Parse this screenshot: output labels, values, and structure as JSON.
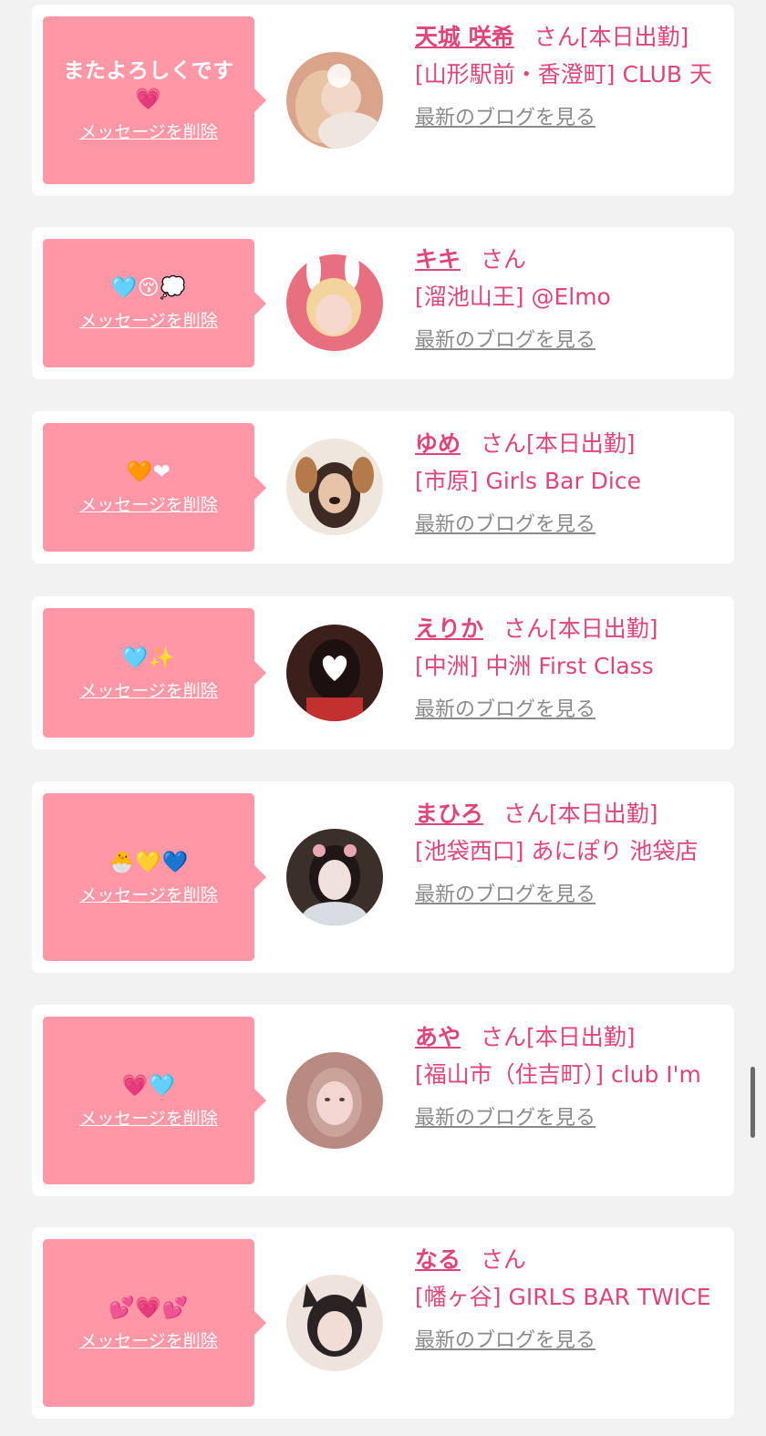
{
  "cards": [
    {
      "message": "またよろしくです💗",
      "delete_label": "メッセージを削除",
      "name": "天城 咲希",
      "san": "さん",
      "status": "[本日出勤]",
      "shop": "[山形駅前・香澄町] CLUB 天",
      "blog_label": "最新のブログを見る",
      "avatar_icon": "avatar-photo-icon",
      "avatar_colors": [
        "#d9a48a",
        "#f1d7c6"
      ]
    },
    {
      "message": "🩵😚💭",
      "delete_label": "メッセージを削除",
      "name": "キキ",
      "san": "さん",
      "status": "",
      "shop": "[溜池山王] @Elmo",
      "blog_label": "最新のブログを見る",
      "avatar_icon": "avatar-photo-icon",
      "avatar_colors": [
        "#e86f7d",
        "#f6d8cf"
      ]
    },
    {
      "message": "🧡❤",
      "delete_label": "メッセージを削除",
      "name": "ゆめ",
      "san": "さん",
      "status": "[本日出勤]",
      "shop": "[市原] Girls Bar Dice",
      "blog_label": "最新のブログを見る",
      "avatar_icon": "avatar-photo-icon",
      "avatar_colors": [
        "#b57a4a",
        "#efe7de"
      ]
    },
    {
      "message": "🩵✨",
      "delete_label": "メッセージを削除",
      "name": "えりか",
      "san": "さん",
      "status": "[本日出勤]",
      "shop": "[中洲] 中洲 First Class",
      "blog_label": "最新のブログを見る",
      "avatar_icon": "avatar-photo-icon",
      "avatar_colors": [
        "#3a1f1a",
        "#c2312f"
      ]
    },
    {
      "message": "🐣💛💙",
      "delete_label": "メッセージを削除",
      "name": "まひろ",
      "san": "さん",
      "status": "[本日出勤]",
      "shop": "[池袋西口] あにぽり 池袋店",
      "blog_label": "最新のブログを見る",
      "avatar_icon": "avatar-photo-icon",
      "avatar_colors": [
        "#3b2f2a",
        "#f0e1dc"
      ]
    },
    {
      "message": "💗🩵",
      "delete_label": "メッセージを削除",
      "name": "あや",
      "san": "さん",
      "status": "[本日出勤]",
      "shop": "[福山市（住吉町）] club I'm",
      "blog_label": "最新のブログを見る",
      "avatar_icon": "avatar-photo-icon",
      "avatar_colors": [
        "#b98a82",
        "#f3d6d2"
      ]
    },
    {
      "message": "💕💗💕",
      "delete_label": "メッセージを削除",
      "name": "なる",
      "san": "さん",
      "status": "",
      "shop": "[幡ヶ谷] GIRLS BAR TWICE",
      "blog_label": "最新のブログを見る",
      "avatar_icon": "avatar-photo-icon",
      "avatar_colors": [
        "#2a2324",
        "#efe3de"
      ]
    }
  ],
  "scrollbar_position": 0.78
}
